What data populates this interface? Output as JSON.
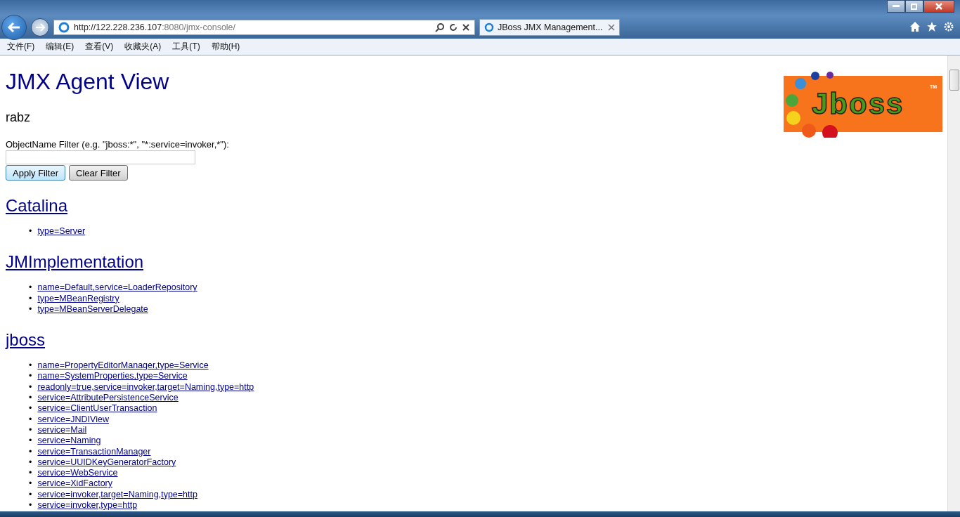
{
  "browser": {
    "address": {
      "host": "http://122.228.236.107",
      "rest": ":8080/jmx-console/"
    },
    "tab": {
      "title": "JBoss JMX Management...",
      "selected": true
    },
    "menu": [
      "文件(F)",
      "编辑(E)",
      "查看(V)",
      "收藏夹(A)",
      "工具(T)",
      "帮助(H)"
    ]
  },
  "page": {
    "title": "JMX Agent View",
    "subtitle": "rabz",
    "logo": {
      "word": "Jboss",
      "mark": "TM"
    },
    "filter": {
      "label": "ObjectName Filter (e.g. \"jboss:*\", \"*:service=invoker,*\"):",
      "buttons": [
        {
          "label": "Apply Filter",
          "focused": true
        },
        {
          "label": "Clear Filter",
          "focused": false
        }
      ]
    },
    "domains": [
      {
        "name": "Catalina",
        "mbeans": [
          {
            "bullet": "•",
            "label": "type=Server"
          }
        ]
      },
      {
        "name": "JMImplementation",
        "mbeans": [
          {
            "bullet": "•",
            "label": "name=Default,service=LoaderRepository"
          },
          {
            "bullet": "•",
            "label": "type=MBeanRegistry"
          },
          {
            "bullet": "•",
            "label": "type=MBeanServerDelegate"
          }
        ]
      },
      {
        "name": "jboss",
        "mbeans": [
          {
            "bullet": "•",
            "label": "name=PropertyEditorManager,type=Service"
          },
          {
            "bullet": "•",
            "label": "name=SystemProperties,type=Service"
          },
          {
            "bullet": "•",
            "label": "readonly=true,service=invoker,target=Naming,type=http"
          },
          {
            "bullet": "•",
            "label": "service=AttributePersistenceService"
          },
          {
            "bullet": "•",
            "label": "service=ClientUserTransaction"
          },
          {
            "bullet": "•",
            "label": "service=JNDIView"
          },
          {
            "bullet": "•",
            "label": "service=Mail"
          },
          {
            "bullet": "•",
            "label": "service=Naming"
          },
          {
            "bullet": "•",
            "label": "service=TransactionManager"
          },
          {
            "bullet": "•",
            "label": "service=UUIDKeyGeneratorFactory"
          },
          {
            "bullet": "•",
            "label": "service=WebService"
          },
          {
            "bullet": "•",
            "label": "service=XidFactory"
          },
          {
            "bullet": "•",
            "label": "service=invoker,target=Naming,type=http"
          },
          {
            "bullet": "•",
            "label": "service=invoker,type=http"
          }
        ]
      }
    ]
  }
}
